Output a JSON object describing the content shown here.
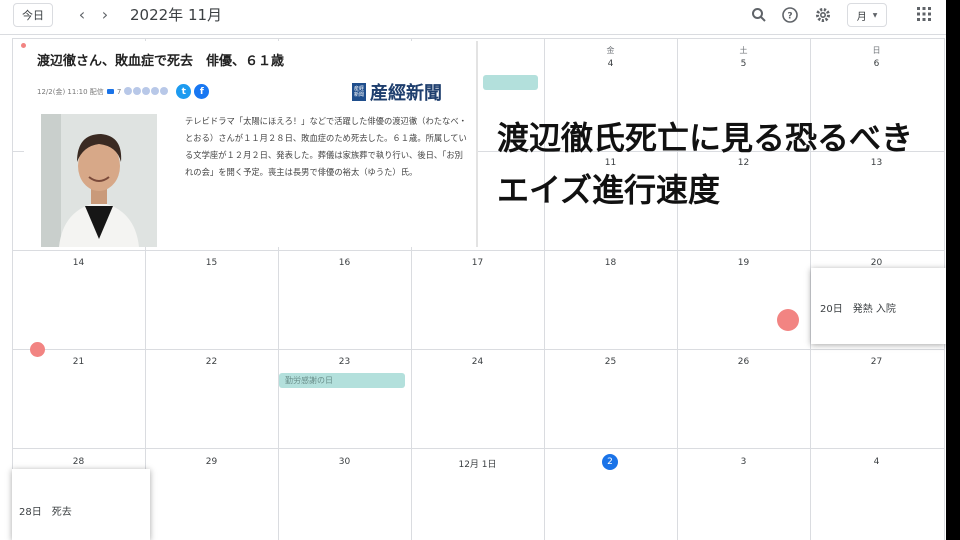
{
  "toolbar": {
    "today_label": "今日",
    "month_title": "2022年 11月",
    "view_label": "月",
    "prev_icon": "chevron-left-icon",
    "next_icon": "chevron-right-icon",
    "search_icon": "search-icon",
    "help_icon": "help-icon",
    "settings_icon": "gear-icon",
    "apps_icon": "apps-grid-icon"
  },
  "calendar": {
    "row1": {
      "dows": [
        "金",
        "土",
        "日"
      ],
      "days": [
        "4",
        "5",
        "6"
      ]
    },
    "row2": {
      "days": [
        "11",
        "12",
        "13"
      ]
    },
    "row3": {
      "days": [
        "14",
        "15",
        "16",
        "17",
        "18",
        "19",
        "20"
      ]
    },
    "row4": {
      "days": [
        "21",
        "22",
        "23",
        "24",
        "25",
        "26",
        "27"
      ]
    },
    "row5": {
      "days": [
        "28",
        "29",
        "30",
        "12月 1日",
        "2",
        "3",
        "4"
      ]
    },
    "events": [
      {
        "label": ""
      },
      {
        "label": "勤労感謝の日"
      }
    ]
  },
  "article": {
    "title": "渡辺徹さん、敗血症で死去　俳優、６１歳",
    "meta_date": "12/2(金) 11:10 配信",
    "comment_count": "7",
    "paper_mark": "産経新聞",
    "paper_name": "産經新聞",
    "body": "テレビドラマ「太陽にほえろ！」などで活躍した俳優の渡辺徹（わたなべ・とおる）さんが１１月２８日、敗血症のため死去した。６１歳。所属している文学座が１２月２日、発表した。葬儀は家族葬で執り行い、後日、「お別れの会」を開く予定。喪主は長男で俳優の裕太（ゆうた）氏。",
    "photo_icon": "person-photo-icon",
    "social": {
      "twitter_icon": "twitter-icon",
      "facebook_icon": "facebook-icon"
    }
  },
  "headline": "渡辺徹氏死亡に見る恐るべきエイズ進行速度",
  "popups": [
    {
      "text": "20日　発熱 入院"
    },
    {
      "text": "28日　死去"
    }
  ],
  "colors": {
    "accent": "#1a73e8",
    "event": "#b3e0dc",
    "marker": "#f28482"
  }
}
